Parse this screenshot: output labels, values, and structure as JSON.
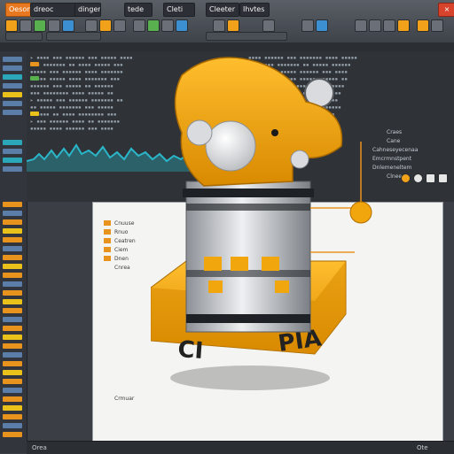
{
  "toolbar": {
    "items": [
      {
        "label": "Oeson",
        "style": "orange"
      },
      {
        "label": "dreoc",
        "style": "plain"
      },
      {
        "label": "dinger",
        "style": "plain"
      },
      {
        "label": "tede",
        "style": "plain"
      },
      {
        "label": "Cleti",
        "style": "plain"
      },
      {
        "label": "Cleeter",
        "style": "plain"
      },
      {
        "label": "Ihvtes",
        "style": "plain"
      }
    ],
    "close_glyph": "×"
  },
  "canvas": {
    "labels": [
      "Cnuuse",
      "Rnuo",
      "Ceatren",
      "Ciem",
      "Dnen",
      "Cnrea"
    ],
    "footer_label": "Crmuar"
  },
  "meta": {
    "lines": [
      "Craes",
      "Cane",
      "Cahneseyecenaa",
      "Emcrmnstpent",
      "Dnlemeneltem",
      "Clnee"
    ]
  },
  "status": {
    "left": "Orea",
    "right": "Ote"
  },
  "robot": {
    "base_text_left": "CI",
    "base_text_right": "PIA"
  },
  "colors": {
    "accent": "#e8931e",
    "robot_yellow": "#f2a60d",
    "robot_shadow": "#c97e00",
    "metal": "#c9ccd0"
  }
}
